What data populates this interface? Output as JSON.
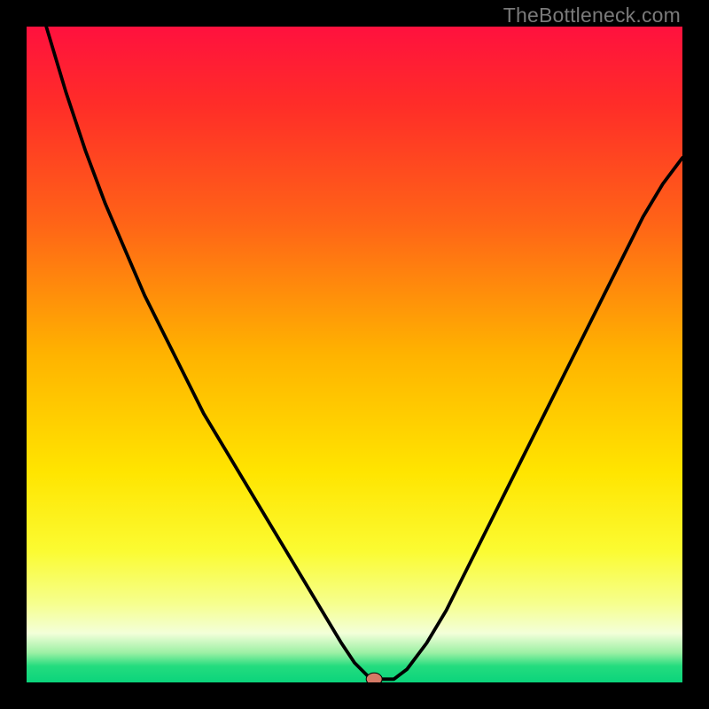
{
  "attribution": "TheBottleneck.com",
  "colors": {
    "frame": "#000000",
    "gradient_stops": [
      {
        "offset": 0.0,
        "color": "#ff113e"
      },
      {
        "offset": 0.12,
        "color": "#ff2d28"
      },
      {
        "offset": 0.3,
        "color": "#ff6417"
      },
      {
        "offset": 0.5,
        "color": "#ffb300"
      },
      {
        "offset": 0.68,
        "color": "#ffe500"
      },
      {
        "offset": 0.8,
        "color": "#fbfb32"
      },
      {
        "offset": 0.88,
        "color": "#f6ff8e"
      },
      {
        "offset": 0.925,
        "color": "#f3ffd9"
      },
      {
        "offset": 0.955,
        "color": "#9bf0a4"
      },
      {
        "offset": 0.975,
        "color": "#24dc7e"
      },
      {
        "offset": 1.0,
        "color": "#0bd47c"
      }
    ],
    "curve": "#000000",
    "marker_fill": "#d47a66",
    "marker_stroke": "#000000"
  },
  "chart_data": {
    "type": "line",
    "title": "",
    "xlabel": "",
    "ylabel": "",
    "xlim": [
      0,
      100
    ],
    "ylim": [
      0,
      100
    ],
    "grid": false,
    "legend": false,
    "annotations": [],
    "marker": {
      "x": 53,
      "y": 0.5
    },
    "series": [
      {
        "name": "bottleneck-curve",
        "x": [
          0,
          3,
          6,
          9,
          12,
          15,
          18,
          21,
          24,
          27,
          30,
          33,
          36,
          39,
          42,
          45,
          48,
          50,
          52,
          54,
          56,
          58,
          61,
          64,
          67,
          70,
          73,
          76,
          79,
          82,
          85,
          88,
          91,
          94,
          97,
          100
        ],
        "y": [
          113,
          100,
          90,
          81,
          73,
          66,
          59,
          53,
          47,
          41,
          36,
          31,
          26,
          21,
          16,
          11,
          6,
          3,
          1,
          0.5,
          0.5,
          2,
          6,
          11,
          17,
          23,
          29,
          35,
          41,
          47,
          53,
          59,
          65,
          71,
          76,
          80
        ]
      }
    ]
  }
}
